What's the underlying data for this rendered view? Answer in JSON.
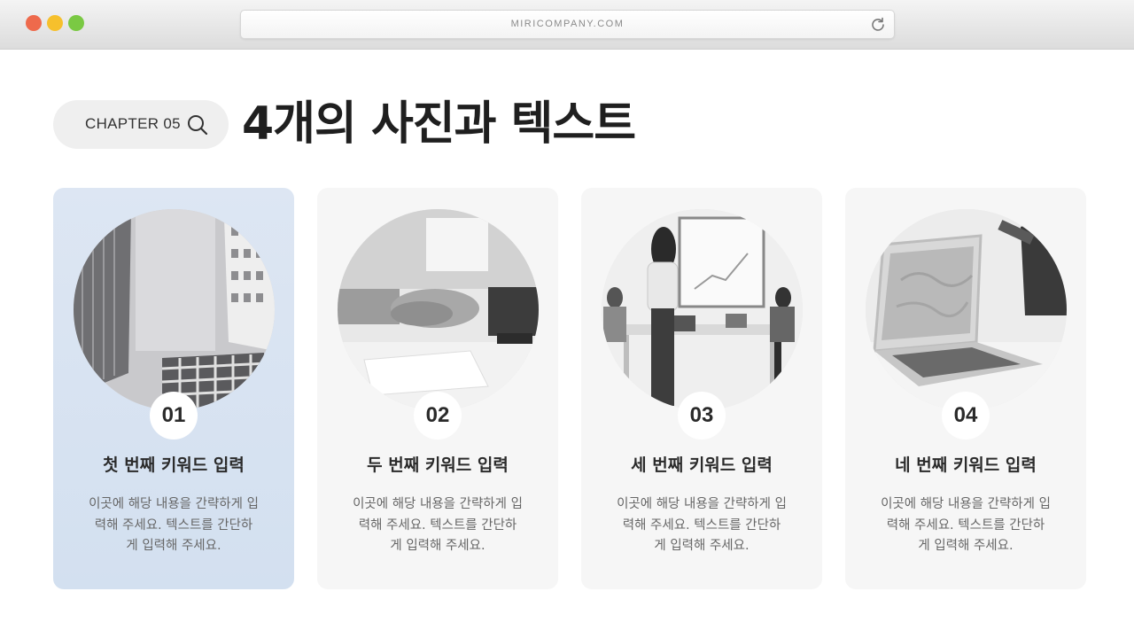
{
  "browser": {
    "url": "MIRICOMPANY.COM",
    "colors": {
      "close": "#ee6a4c",
      "minimize": "#f6c02c",
      "maximize": "#7ac943"
    }
  },
  "header": {
    "chapter": "CHAPTER 05",
    "chapter_icon": "search-icon",
    "title": "4개의 사진과 텍스트"
  },
  "accent_color": "#d8e3f2",
  "cards": [
    {
      "number": "01",
      "heading": "첫 번째 키워드 입력",
      "photo": "skyscrapers-photo",
      "body": [
        "이곳에 해당 내용을 간략하게 입",
        "력해 주세요. 텍스트를 간단하",
        "게 입력해 주세요."
      ]
    },
    {
      "number": "02",
      "heading": "두 번째 키워드 입력",
      "photo": "handshake-photo",
      "body": [
        "이곳에 해당 내용을 간략하게 입",
        "력해 주세요. 텍스트를 간단하",
        "게 입력해 주세요."
      ]
    },
    {
      "number": "03",
      "heading": "세 번째 키워드 입력",
      "photo": "presentation-photo",
      "body": [
        "이곳에 해당 내용을 간략하게 입",
        "력해 주세요. 텍스트를 간단하",
        "게 입력해 주세요."
      ]
    },
    {
      "number": "04",
      "heading": "네 번째 키워드 입력",
      "photo": "laptop-photo",
      "body": [
        "이곳에 해당 내용을 간략하게 입",
        "력해 주세요. 텍스트를 간단하",
        "게 입력해 주세요."
      ]
    }
  ]
}
